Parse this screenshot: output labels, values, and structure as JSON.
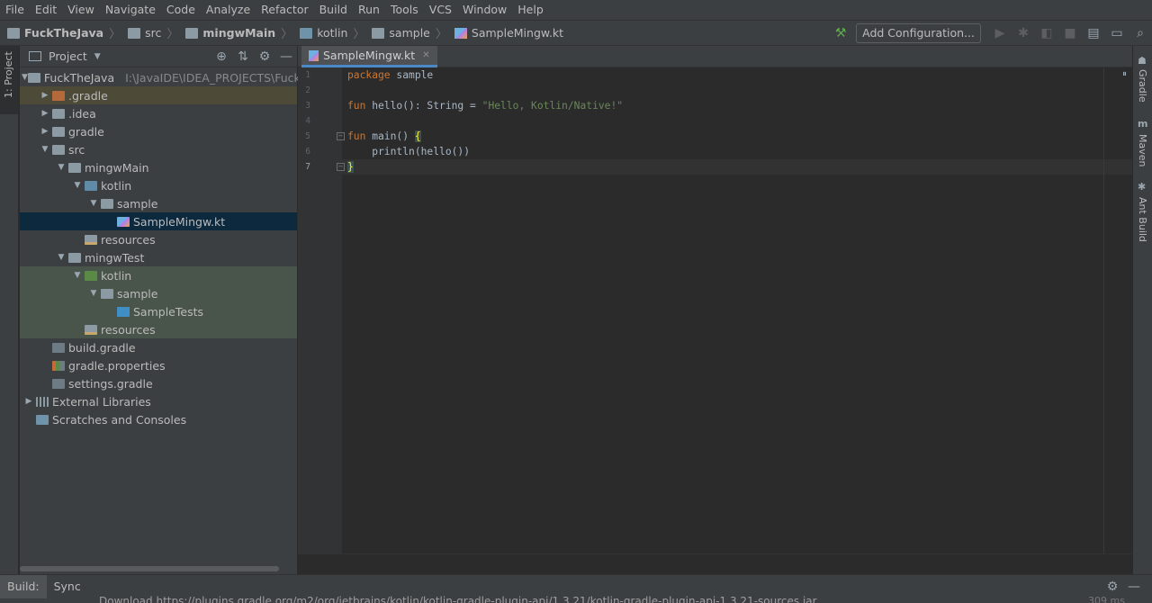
{
  "menu": [
    "File",
    "Edit",
    "View",
    "Navigate",
    "Code",
    "Analyze",
    "Refactor",
    "Build",
    "Run",
    "Tools",
    "VCS",
    "Window",
    "Help"
  ],
  "breadcrumb": [
    {
      "label": "FuckTheJava",
      "bold": true,
      "icon": "module-folder-icon"
    },
    {
      "label": "src",
      "bold": false,
      "icon": "folder-icon"
    },
    {
      "label": "mingwMain",
      "bold": true,
      "icon": "module-folder-icon"
    },
    {
      "label": "kotlin",
      "bold": false,
      "icon": "source-folder-icon"
    },
    {
      "label": "sample",
      "bold": false,
      "icon": "package-icon"
    },
    {
      "label": "SampleMingw.kt",
      "bold": false,
      "icon": "kotlin-file-icon"
    }
  ],
  "toolbar": {
    "add_configuration": "Add Configuration..."
  },
  "left_stripe": {
    "project_tab": "1: Project"
  },
  "project_panel": {
    "title": "Project",
    "root_path": "I:\\JavaIDE\\IDEA_PROJECTS\\FuckTheJ",
    "tree": [
      {
        "label": "FuckTheJava",
        "depth": 0,
        "arrow": "down",
        "icon": "ico-grey",
        "style": "",
        "path": true
      },
      {
        "label": ".gradle",
        "depth": 1,
        "arrow": "right",
        "icon": "ico-orange",
        "style": "excluded"
      },
      {
        "label": ".idea",
        "depth": 1,
        "arrow": "right",
        "icon": "ico-grey",
        "style": ""
      },
      {
        "label": "gradle",
        "depth": 1,
        "arrow": "right",
        "icon": "ico-grey",
        "style": ""
      },
      {
        "label": "src",
        "depth": 1,
        "arrow": "down",
        "icon": "ico-grey",
        "style": ""
      },
      {
        "label": "mingwMain",
        "depth": 2,
        "arrow": "down",
        "icon": "ico-grey",
        "style": ""
      },
      {
        "label": "kotlin",
        "depth": 3,
        "arrow": "down",
        "icon": "ico-blue",
        "style": ""
      },
      {
        "label": "sample",
        "depth": 4,
        "arrow": "down",
        "icon": "ico-grey",
        "style": ""
      },
      {
        "label": "SampleMingw.kt",
        "depth": 5,
        "arrow": "none",
        "icon": "ico-kt",
        "style": "sel"
      },
      {
        "label": "resources",
        "depth": 3,
        "arrow": "none",
        "icon": "ico-res",
        "style": ""
      },
      {
        "label": "mingwTest",
        "depth": 2,
        "arrow": "down",
        "icon": "ico-grey",
        "style": ""
      },
      {
        "label": "kotlin",
        "depth": 3,
        "arrow": "down",
        "icon": "ico-green",
        "style": "test"
      },
      {
        "label": "sample",
        "depth": 4,
        "arrow": "down",
        "icon": "ico-grey",
        "style": "test"
      },
      {
        "label": "SampleTests",
        "depth": 5,
        "arrow": "none",
        "icon": "ico-test",
        "style": "test"
      },
      {
        "label": "resources",
        "depth": 3,
        "arrow": "none",
        "icon": "ico-res",
        "style": "test"
      },
      {
        "label": "build.gradle",
        "depth": 1,
        "arrow": "none",
        "icon": "ico-gradle",
        "style": ""
      },
      {
        "label": "gradle.properties",
        "depth": 1,
        "arrow": "none",
        "icon": "ico-props",
        "style": ""
      },
      {
        "label": "settings.gradle",
        "depth": 1,
        "arrow": "none",
        "icon": "ico-gradle",
        "style": ""
      },
      {
        "label": "External Libraries",
        "depth": 0,
        "arrow": "right",
        "icon": "ico-lib",
        "style": ""
      },
      {
        "label": "Scratches and Consoles",
        "depth": 0,
        "arrow": "none",
        "icon": "ico-scratch",
        "style": ""
      }
    ]
  },
  "editor": {
    "tab_label": "SampleMingw.kt",
    "line_numbers": [
      "1",
      "2",
      "3",
      "4",
      "5",
      "6",
      "7"
    ],
    "current_line": 7
  },
  "right_stripe": {
    "gradle": "Gradle",
    "maven": "Maven",
    "ant": "Ant Build"
  },
  "bottom": {
    "build_label": "Build:",
    "sync_tab": "Sync",
    "output_line": "Download https://plugins.gradle.org/m2/org/jetbrains/kotlin/kotlin-gradle-plugin-api/1.3.21/kotlin-gradle-plugin-api-1.3.21-sources.jar",
    "time": "309 ms"
  },
  "colors": {
    "keyword": "#cc7832",
    "string": "#6a8759",
    "selection": "#0d293e",
    "accent": "#4a88c7"
  }
}
